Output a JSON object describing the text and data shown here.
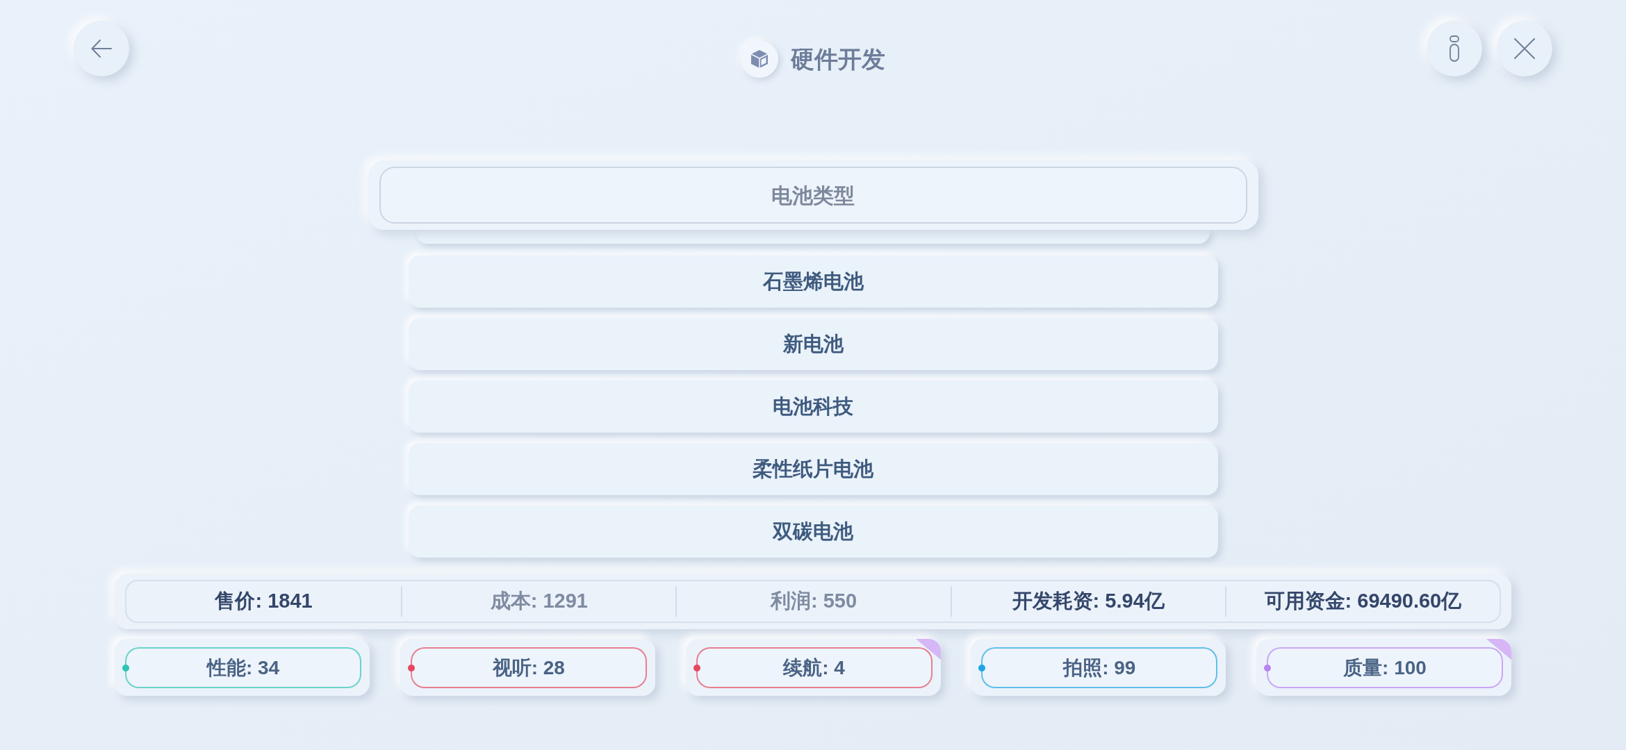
{
  "header": {
    "title": "硬件开发"
  },
  "dropdown": {
    "label": "电池类型",
    "options": [
      "石墨烯电池",
      "新电池",
      "电池科技",
      "柔性纸片电池",
      "双碳电池"
    ]
  },
  "summary": [
    {
      "text": "售价: 1841",
      "muted": false
    },
    {
      "text": "成本: 1291",
      "muted": true
    },
    {
      "text": "利润: 550",
      "muted": true
    },
    {
      "text": "开发耗资: 5.94亿",
      "muted": false
    },
    {
      "text": "可用资金: 69490.60亿",
      "muted": false
    }
  ],
  "attributes": [
    {
      "text": "性能: 34",
      "color": "#2ec4b4",
      "corner_mark": false
    },
    {
      "text": "视听: 28",
      "color": "#e5485f",
      "corner_mark": false
    },
    {
      "text": "续航: 4",
      "color": "#e5485f",
      "corner_mark": true
    },
    {
      "text": "拍照: 99",
      "color": "#1ea5e6",
      "corner_mark": false
    },
    {
      "text": "质量: 100",
      "color": "#b784f0",
      "corner_mark": true
    }
  ]
}
